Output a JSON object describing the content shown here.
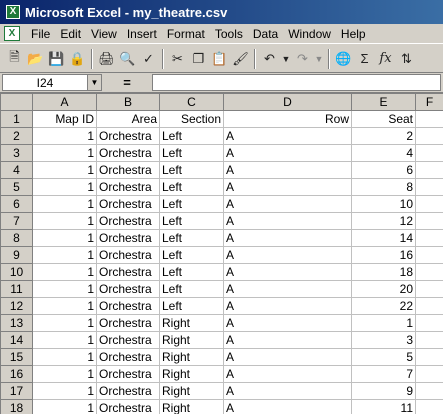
{
  "window": {
    "title": "Microsoft Excel - my_theatre.csv"
  },
  "menu": [
    "File",
    "Edit",
    "View",
    "Insert",
    "Format",
    "Tools",
    "Data",
    "Window",
    "Help"
  ],
  "toolbar": {
    "icons": [
      "new-icon",
      "open-icon",
      "save-icon",
      "permission-icon",
      "print-icon",
      "print-preview-icon",
      "spelling-icon",
      "cut-icon",
      "copy-icon",
      "paste-icon",
      "format-painter-icon",
      "undo-icon",
      "redo-icon",
      "hyperlink-icon",
      "autosum-icon",
      "function-icon",
      "sort-ascending-icon"
    ],
    "autosum_glyph": "Σ",
    "function_glyph": "fx"
  },
  "formula_bar": {
    "name_box": "I24",
    "equals": "=",
    "content": ""
  },
  "columns": [
    "A",
    "B",
    "C",
    "D",
    "E",
    "F"
  ],
  "rows": [
    {
      "n": "1",
      "cells": [
        "Map ID",
        "Area",
        "Section",
        "Row",
        "Seat",
        ""
      ]
    },
    {
      "n": "2",
      "cells": [
        "1",
        "Orchestra",
        "Left",
        "A",
        "2",
        ""
      ]
    },
    {
      "n": "3",
      "cells": [
        "1",
        "Orchestra",
        "Left",
        "A",
        "4",
        ""
      ]
    },
    {
      "n": "4",
      "cells": [
        "1",
        "Orchestra",
        "Left",
        "A",
        "6",
        ""
      ]
    },
    {
      "n": "5",
      "cells": [
        "1",
        "Orchestra",
        "Left",
        "A",
        "8",
        ""
      ]
    },
    {
      "n": "6",
      "cells": [
        "1",
        "Orchestra",
        "Left",
        "A",
        "10",
        ""
      ]
    },
    {
      "n": "7",
      "cells": [
        "1",
        "Orchestra",
        "Left",
        "A",
        "12",
        ""
      ]
    },
    {
      "n": "8",
      "cells": [
        "1",
        "Orchestra",
        "Left",
        "A",
        "14",
        ""
      ]
    },
    {
      "n": "9",
      "cells": [
        "1",
        "Orchestra",
        "Left",
        "A",
        "16",
        ""
      ]
    },
    {
      "n": "10",
      "cells": [
        "1",
        "Orchestra",
        "Left",
        "A",
        "18",
        ""
      ]
    },
    {
      "n": "11",
      "cells": [
        "1",
        "Orchestra",
        "Left",
        "A",
        "20",
        ""
      ]
    },
    {
      "n": "12",
      "cells": [
        "1",
        "Orchestra",
        "Left",
        "A",
        "22",
        ""
      ]
    },
    {
      "n": "13",
      "cells": [
        "1",
        "Orchestra",
        "Right",
        "A",
        "1",
        ""
      ]
    },
    {
      "n": "14",
      "cells": [
        "1",
        "Orchestra",
        "Right",
        "A",
        "3",
        ""
      ]
    },
    {
      "n": "15",
      "cells": [
        "1",
        "Orchestra",
        "Right",
        "A",
        "5",
        ""
      ]
    },
    {
      "n": "16",
      "cells": [
        "1",
        "Orchestra",
        "Right",
        "A",
        "7",
        ""
      ]
    },
    {
      "n": "17",
      "cells": [
        "1",
        "Orchestra",
        "Right",
        "A",
        "9",
        ""
      ]
    },
    {
      "n": "18",
      "cells": [
        "1",
        "Orchestra",
        "Right",
        "A",
        "11",
        ""
      ]
    }
  ],
  "colors": {
    "title_bar": "#0a246a",
    "chrome": "#d4d0c8",
    "gridline": "#c0c0c0"
  }
}
